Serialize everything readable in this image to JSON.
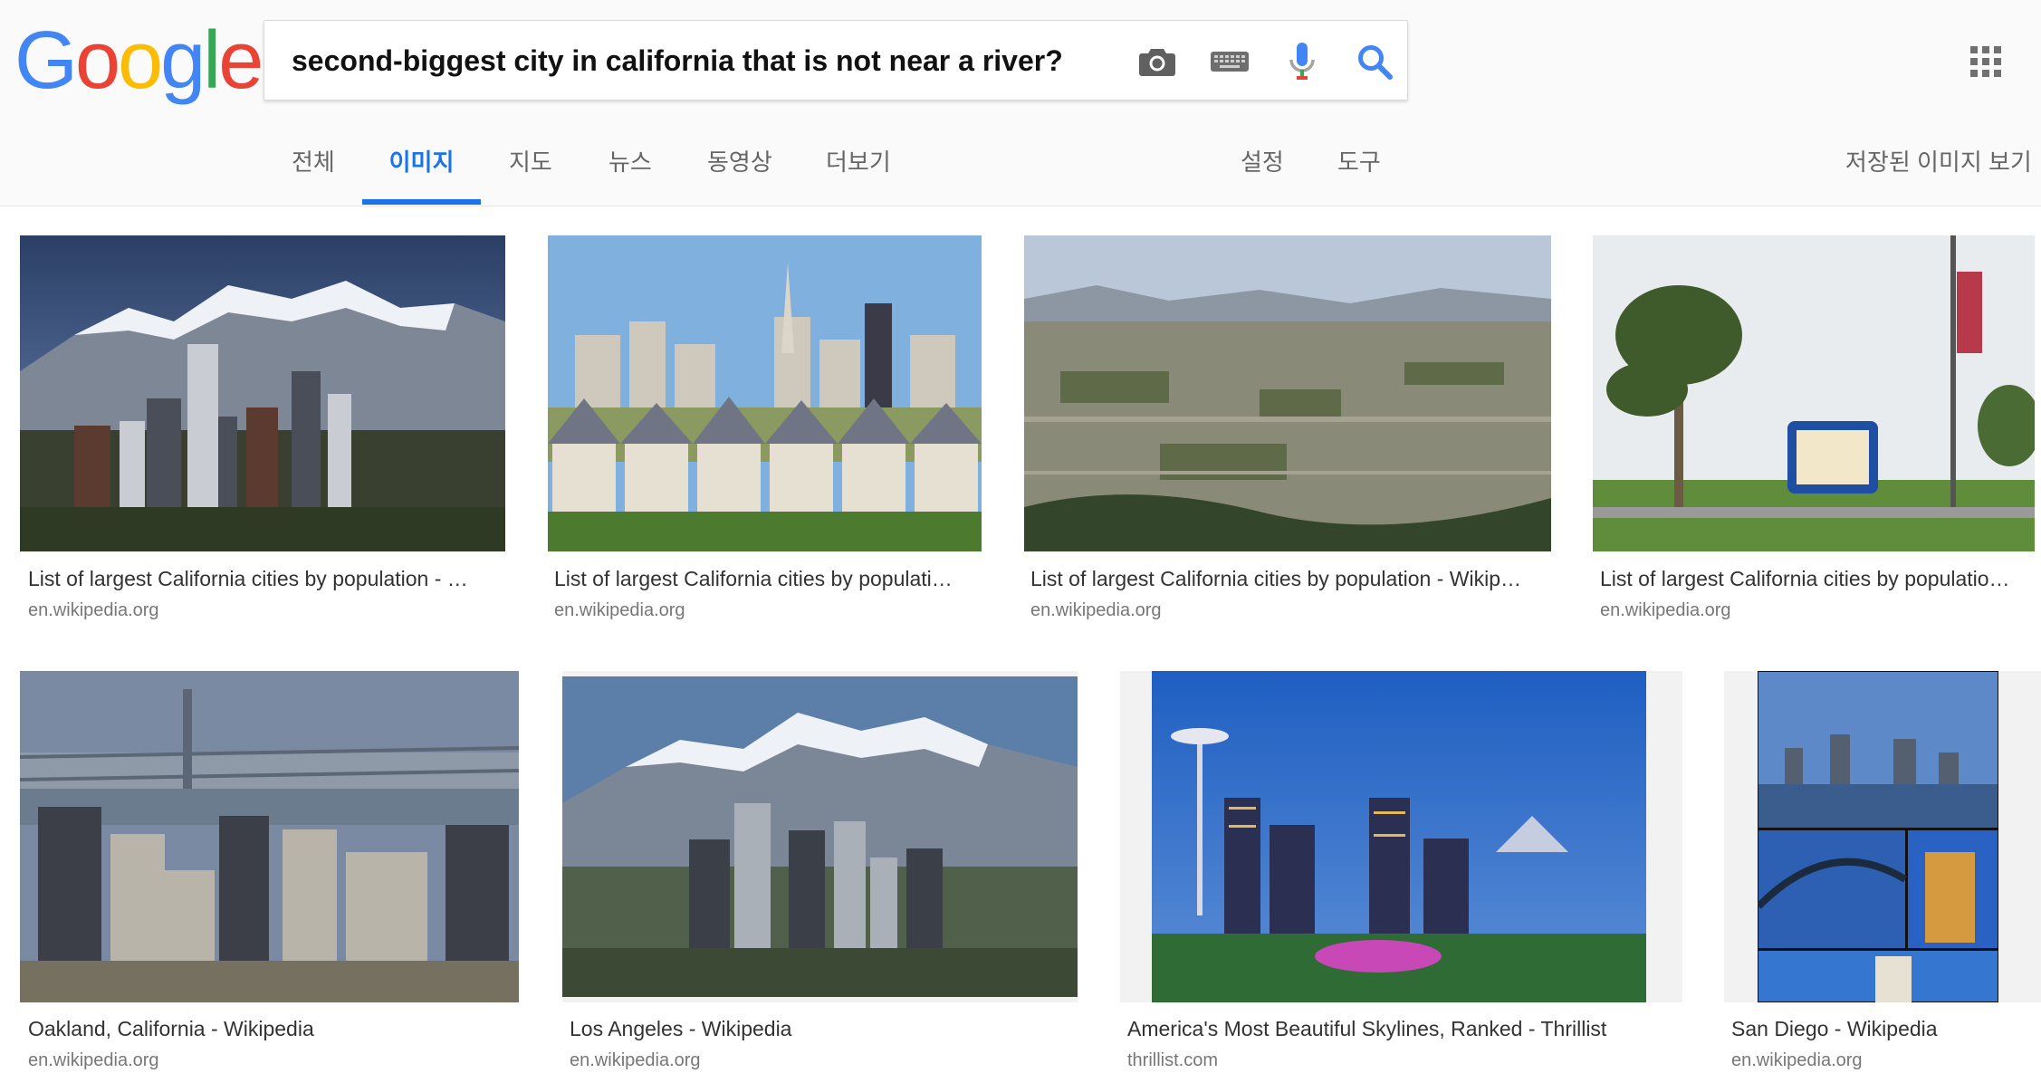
{
  "logo": {
    "letters": [
      "G",
      "o",
      "o",
      "g",
      "l",
      "e"
    ],
    "colors": [
      "#4285f4",
      "#ea4335",
      "#fbbc05",
      "#4285f4",
      "#34a853",
      "#ea4335"
    ]
  },
  "search": {
    "query": "second-biggest city in california that is not near a river?",
    "icons": [
      "camera-icon",
      "keyboard-icon",
      "microphone-icon",
      "search-icon"
    ]
  },
  "tabs": {
    "all": "전체",
    "images": "이미지",
    "maps": "지도",
    "news": "뉴스",
    "videos": "동영상",
    "more": "더보기",
    "settings": "설정",
    "tools": "도구",
    "saved": "저장된 이미지 보기"
  },
  "accent_color": "#1a73e8",
  "results": [
    {
      "title": "List of largest California cities by population - …",
      "source": "en.wikipedia.org",
      "scene": "mountain-skyline"
    },
    {
      "title": "List of largest California cities by populati…",
      "source": "en.wikipedia.org",
      "scene": "painted-ladies"
    },
    {
      "title": "List of largest California cities by population - Wikip…",
      "source": "en.wikipedia.org",
      "scene": "valley-city"
    },
    {
      "title": "List of largest California cities by populatio…",
      "source": "en.wikipedia.org",
      "scene": "palm-street"
    },
    {
      "title": "Oakland, California - Wikipedia",
      "source": "en.wikipedia.org",
      "scene": "bridge-skyline"
    },
    {
      "title": "Los Angeles - Wikipedia",
      "source": "en.wikipedia.org",
      "scene": "mountain-skyline-2"
    },
    {
      "title": "America's Most Beautiful Skylines, Ranked - Thrillist",
      "source": "thrillist.com",
      "scene": "seattle-night"
    },
    {
      "title": "San Diego - Wikipedia",
      "source": "en.wikipedia.org",
      "scene": "san-diego-collage"
    }
  ]
}
